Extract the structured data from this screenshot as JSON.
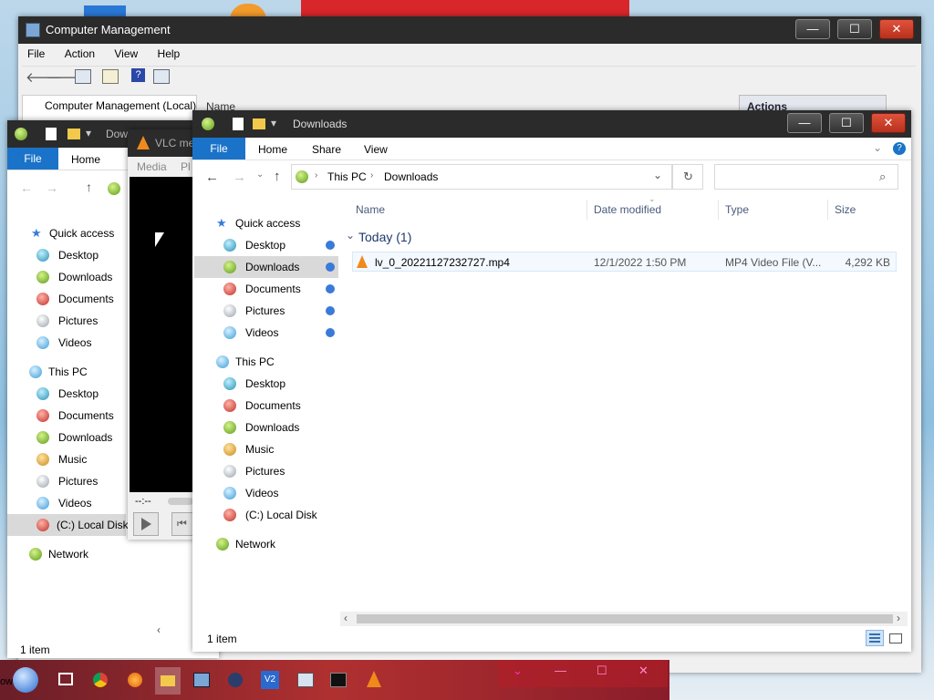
{
  "computer_management": {
    "title": "Computer Management",
    "menu": [
      "File",
      "Action",
      "View",
      "Help"
    ],
    "tree_root": "Computer Management (Local)",
    "actions_header": "Actions",
    "name_col": "Name"
  },
  "back_explorer": {
    "title": "Downloads",
    "ribbon_tabs": [
      "File",
      "Home"
    ],
    "nav": {
      "quick_access": "Quick access",
      "qa_items": [
        "Desktop",
        "Downloads",
        "Documents",
        "Pictures",
        "Videos"
      ],
      "this_pc": "This PC",
      "pc_items": [
        "Desktop",
        "Documents",
        "Downloads",
        "Music",
        "Pictures",
        "Videos",
        "(C:) Local Disk"
      ],
      "network": "Network"
    },
    "status": "1 item"
  },
  "vlc": {
    "title": "VLC media player",
    "menu": [
      "Media",
      "Pl"
    ],
    "time": "--:--"
  },
  "explorer": {
    "title": "Downloads",
    "ribbon_tabs": [
      "File",
      "Home",
      "Share",
      "View"
    ],
    "address": {
      "root": "This PC",
      "current": "Downloads"
    },
    "search_placeholder": "",
    "nav": {
      "quick_access": "Quick access",
      "qa_items": [
        "Desktop",
        "Downloads",
        "Documents",
        "Pictures",
        "Videos"
      ],
      "this_pc": "This PC",
      "pc_items": [
        "Desktop",
        "Documents",
        "Downloads",
        "Music",
        "Pictures",
        "Videos",
        "(C:) Local Disk"
      ],
      "network": "Network"
    },
    "columns": [
      "Name",
      "Date modified",
      "Type",
      "Size"
    ],
    "group": "Today (1)",
    "file": {
      "name": "lv_0_20221127232727.mp4",
      "date": "12/1/2022 1:50 PM",
      "type": "MP4 Video File (V...",
      "size": "4,292 KB"
    },
    "status": "1 item"
  },
  "taskbar": {
    "partial_label": "ow s"
  },
  "colors": {
    "accent": "#1a73c9",
    "title_dark": "#2b2b2b",
    "selection": "#cce4f7",
    "close_red": "#c8361f"
  }
}
